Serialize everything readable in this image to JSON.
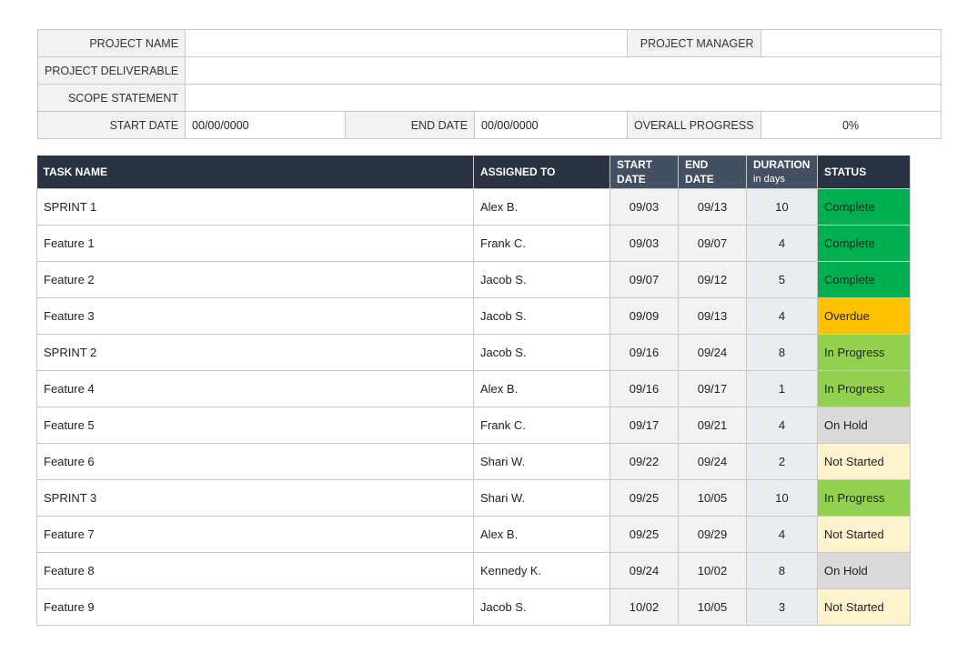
{
  "project": {
    "name_label": "PROJECT NAME",
    "name_value": "",
    "manager_label": "PROJECT MANAGER",
    "manager_value": "",
    "deliverable_label": "PROJECT DELIVERABLE",
    "deliverable_value": "",
    "scope_label": "SCOPE STATEMENT",
    "scope_value": "",
    "start_label": "START DATE",
    "start_value": "00/00/0000",
    "end_label": "END DATE",
    "end_value": "00/00/0000",
    "progress_label": "OVERALL PROGRESS",
    "progress_value": "0%"
  },
  "columns": {
    "task": "TASK NAME",
    "assigned": "ASSIGNED TO",
    "start_1": "START",
    "start_2": "DATE",
    "end_1": "END",
    "end_2": "DATE",
    "duration_1": "DURATION",
    "duration_2": "in days",
    "status": "STATUS"
  },
  "rows": [
    {
      "task": "SPRINT 1",
      "assigned": "Alex B.",
      "start": "09/03",
      "end": "09/13",
      "duration": "10",
      "status": "Complete"
    },
    {
      "task": "Feature 1",
      "assigned": "Frank C.",
      "start": "09/03",
      "end": "09/07",
      "duration": "4",
      "status": "Complete"
    },
    {
      "task": "Feature 2",
      "assigned": "Jacob S.",
      "start": "09/07",
      "end": "09/12",
      "duration": "5",
      "status": "Complete"
    },
    {
      "task": "Feature 3",
      "assigned": "Jacob S.",
      "start": "09/09",
      "end": "09/13",
      "duration": "4",
      "status": "Overdue"
    },
    {
      "task": "SPRINT 2",
      "assigned": "Jacob S.",
      "start": "09/16",
      "end": "09/24",
      "duration": "8",
      "status": "In Progress"
    },
    {
      "task": "Feature 4",
      "assigned": "Alex B.",
      "start": "09/16",
      "end": "09/17",
      "duration": "1",
      "status": "In Progress"
    },
    {
      "task": "Feature 5",
      "assigned": "Frank C.",
      "start": "09/17",
      "end": "09/21",
      "duration": "4",
      "status": "On Hold"
    },
    {
      "task": "Feature 6",
      "assigned": "Shari W.",
      "start": "09/22",
      "end": "09/24",
      "duration": "2",
      "status": "Not Started"
    },
    {
      "task": "SPRINT 3",
      "assigned": "Shari W.",
      "start": "09/25",
      "end": "10/05",
      "duration": "10",
      "status": "In Progress"
    },
    {
      "task": "Feature 7",
      "assigned": "Alex B.",
      "start": "09/25",
      "end": "09/29",
      "duration": "4",
      "status": "Not Started"
    },
    {
      "task": "Feature 8",
      "assigned": "Kennedy K.",
      "start": "09/24",
      "end": "10/02",
      "duration": "8",
      "status": "On Hold"
    },
    {
      "task": "Feature 9",
      "assigned": "Jacob S.",
      "start": "10/02",
      "end": "10/05",
      "duration": "3",
      "status": "Not Started"
    }
  ],
  "status_colors": {
    "Complete": "#00b050",
    "Overdue": "#ffc000",
    "In Progress": "#92d050",
    "On Hold": "#d9d9d9",
    "Not Started": "#fff2cc"
  }
}
